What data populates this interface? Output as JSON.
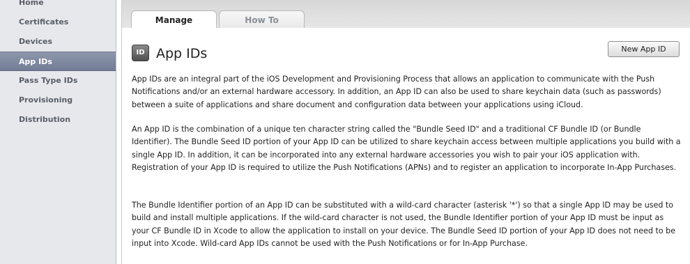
{
  "sidebar": {
    "items": [
      {
        "label": "Home"
      },
      {
        "label": "Certificates"
      },
      {
        "label": "Devices"
      },
      {
        "label": "App IDs",
        "active": true
      },
      {
        "label": "Pass Type IDs"
      },
      {
        "label": "Provisioning"
      },
      {
        "label": "Distribution"
      }
    ]
  },
  "tabs": [
    {
      "label": "Manage",
      "active": true
    },
    {
      "label": "How To",
      "active": false
    }
  ],
  "header": {
    "icon_text": "ID",
    "title": "App IDs",
    "new_button_label": "New App ID"
  },
  "paragraphs": [
    "App IDs are an integral part of the iOS Development and Provisioning Process that allows an application to communicate with the Push Notifications and/or an external hardware accessory. In addition, an App ID can also be used to share keychain data (such as passwords) between a suite of applications and share document and configuration data between your applications using iCloud.",
    "An App ID is the combination of a unique ten character string called the \"Bundle Seed ID\" and a traditional CF Bundle ID (or Bundle Identifier). The Bundle Seed ID portion of your App ID can be utilized to share keychain access between multiple applications you build with a single App ID. In addition, it can be incorporated into any external hardware accessories you wish to pair your iOS application with. Registration of your App ID is required to utilize the Push Notifications (APNs) and to register an application to incorporate In-App Purchases.",
    "The Bundle Identifier portion of an App ID can be substituted with a wild-card character (asterisk '*') so that a single App ID may be used to build and install multiple applications. If the wild-card character is not used, the Bundle Identifier portion of your App ID must be input as your CF Bundle ID in Xcode to allow the application to install on your device. The Bundle Seed ID portion of your App ID does not need to be input into Xcode. Wild-card App IDs cannot be used with the Push Notifications or for In-App Purchase."
  ],
  "colors": {
    "sidebar_bg": "#e6e8ec",
    "sidebar_active": "#7a849b",
    "tabbar_bg": "#dcdcdc"
  }
}
